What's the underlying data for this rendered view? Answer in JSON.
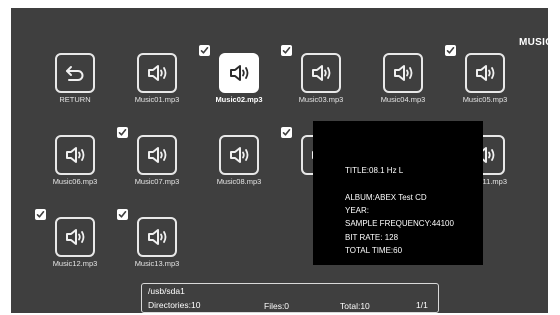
{
  "header": {
    "title": "MUSIC"
  },
  "grid": {
    "items": [
      {
        "label": "RETURN",
        "icon": "return-icon",
        "checked": false,
        "selected": false
      },
      {
        "label": "Music01.mp3",
        "icon": "speaker-icon",
        "checked": false,
        "selected": false
      },
      {
        "label": "Music02.mp3",
        "icon": "speaker-icon",
        "checked": true,
        "selected": true
      },
      {
        "label": "Music03.mp3",
        "icon": "speaker-icon",
        "checked": true,
        "selected": false
      },
      {
        "label": "Music04.mp3",
        "icon": "speaker-icon",
        "checked": false,
        "selected": false
      },
      {
        "label": "Music05.mp3",
        "icon": "speaker-icon",
        "checked": true,
        "selected": false
      },
      {
        "label": "Music06.mp3",
        "icon": "speaker-icon",
        "checked": false,
        "selected": false
      },
      {
        "label": "Music07.mp3",
        "icon": "speaker-icon",
        "checked": true,
        "selected": false
      },
      {
        "label": "Music08.mp3",
        "icon": "speaker-icon",
        "checked": false,
        "selected": false
      },
      {
        "label": "",
        "icon": "speaker-icon",
        "checked": true,
        "selected": false
      },
      {
        "label": "",
        "icon": "speaker-icon",
        "checked": false,
        "selected": false
      },
      {
        "label": "Music11.mp3",
        "icon": "speaker-icon",
        "checked": false,
        "selected": false
      },
      {
        "label": "Music12.mp3",
        "icon": "speaker-icon",
        "checked": true,
        "selected": false
      },
      {
        "label": "Music13.mp3",
        "icon": "speaker-icon",
        "checked": true,
        "selected": false
      }
    ]
  },
  "info_popup": {
    "title": "TITLE:08.1 Hz L",
    "album": "ALBUM:ABEX Test CD",
    "year": "YEAR:",
    "sample_frequency": "SAMPLE  FREQUENCY:44100",
    "bit_rate": "BIT RATE: 128",
    "total_time": "TOTAL TIME:60"
  },
  "status_bar": {
    "path": "/usb/sda1",
    "directories": "Directories:10",
    "files": "Files:0",
    "total": "Total:10",
    "page": "1/1"
  },
  "colors": {
    "panel_background": "#3f3f3f",
    "popup_background": "#000000",
    "selected_tile": "#ffffff",
    "text": "#ffffff"
  }
}
